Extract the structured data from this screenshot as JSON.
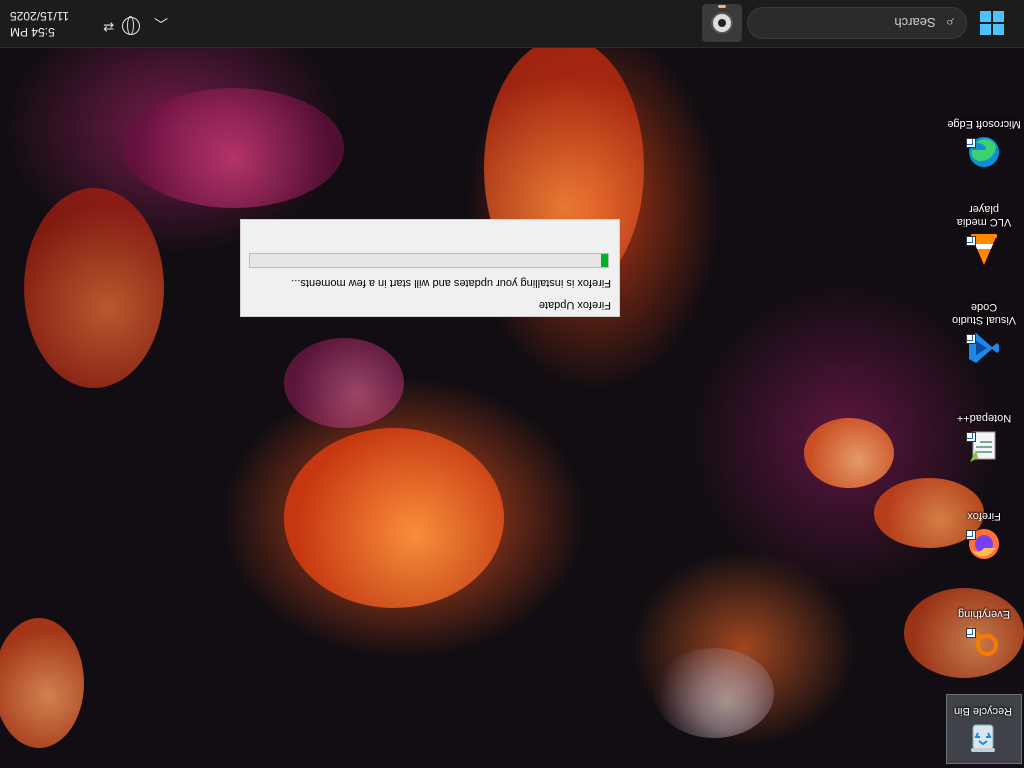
{
  "taskbar": {
    "search_placeholder": "Search",
    "search_icon": "search-icon",
    "start_icon": "windows-start-icon",
    "pinned_app_icon": "webcam-app-icon",
    "clock": {
      "time": "5:54 PM",
      "date": "11/15/2025"
    },
    "tray": {
      "chevron_icon": "chevron-up-icon",
      "globe_icon": "globe-icon",
      "network_icon": "network-icon"
    }
  },
  "desktop_icons": [
    {
      "label": "Recycle Bin",
      "icon": "recycle-bin-icon"
    },
    {
      "label": "Everything",
      "icon": "everything-icon"
    },
    {
      "label": "Firefox",
      "icon": "firefox-icon"
    },
    {
      "label": "Notepad++",
      "icon": "notepad-plus-plus-icon"
    },
    {
      "label": "Visual Studio Code",
      "icon": "vscode-icon"
    },
    {
      "label": "VLC media player",
      "icon": "vlc-icon"
    },
    {
      "label": "Microsoft Edge",
      "icon": "edge-icon"
    }
  ],
  "update_dialog": {
    "title": "Firefox Update",
    "message": "Firefox is installing your updates and will start in a few moments...",
    "progress": 0.02
  },
  "colors": {
    "taskbar_bg": "#1c1c1c",
    "accent": "#4cc2ff",
    "progress": "#06b025"
  },
  "screen_rotation_degrees": 180
}
